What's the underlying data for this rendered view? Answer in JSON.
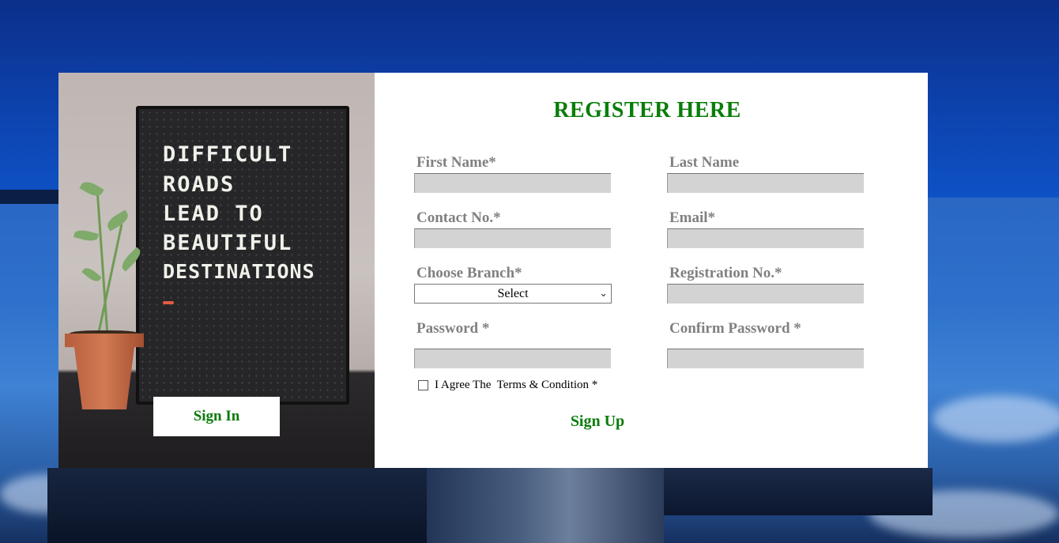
{
  "left_panel": {
    "quote_lines": [
      "DIFFICULT",
      "ROADS",
      "LEAD TO",
      "BEAUTIFUL",
      "DESTINATIONS"
    ],
    "signin_label": "Sign In"
  },
  "form": {
    "title": "REGISTER HERE",
    "fields": {
      "first_name": {
        "label": "First Name*",
        "value": ""
      },
      "last_name": {
        "label": "Last Name",
        "value": ""
      },
      "contact": {
        "label": "Contact No.*",
        "value": ""
      },
      "email": {
        "label": "Email*",
        "value": ""
      },
      "branch": {
        "label": "Choose Branch*",
        "selected": "Select"
      },
      "registration": {
        "label": "Registration No.*",
        "value": ""
      },
      "password": {
        "label": "Password *",
        "value": ""
      },
      "confirm_password": {
        "label": "Confirm Password *",
        "value": ""
      }
    },
    "agree_text": "I Agree The  Terms & Condition *",
    "signup_label": "Sign Up"
  },
  "colors": {
    "accent_green": "#0a7d0a",
    "label_gray": "#808080",
    "input_bg": "#d3d3d3"
  },
  "icons": {
    "select_chevron": "chevron-down-icon",
    "agree_checkbox": "checkbox-icon"
  }
}
